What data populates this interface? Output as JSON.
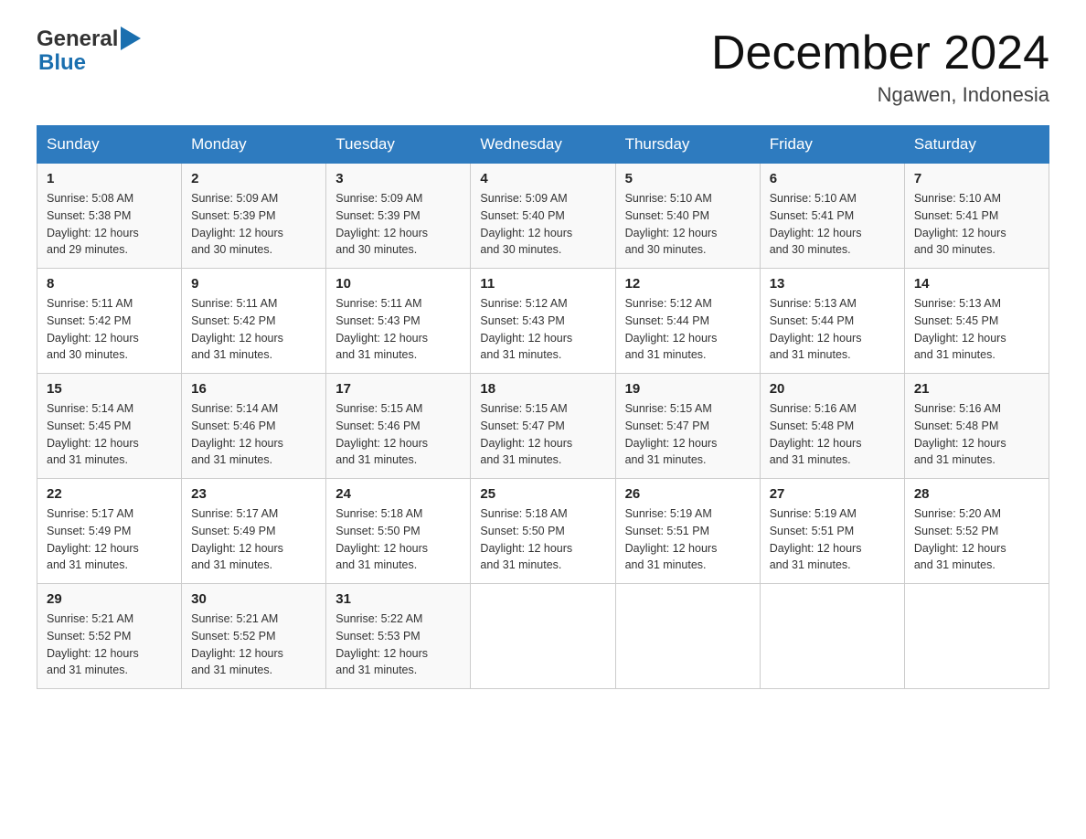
{
  "header": {
    "logo_general": "General",
    "logo_blue": "Blue",
    "month_title": "December 2024",
    "location": "Ngawen, Indonesia"
  },
  "days_of_week": [
    "Sunday",
    "Monday",
    "Tuesday",
    "Wednesday",
    "Thursday",
    "Friday",
    "Saturday"
  ],
  "weeks": [
    {
      "days": [
        {
          "num": "1",
          "sunrise": "5:08 AM",
          "sunset": "5:38 PM",
          "daylight": "12 hours and 29 minutes."
        },
        {
          "num": "2",
          "sunrise": "5:09 AM",
          "sunset": "5:39 PM",
          "daylight": "12 hours and 30 minutes."
        },
        {
          "num": "3",
          "sunrise": "5:09 AM",
          "sunset": "5:39 PM",
          "daylight": "12 hours and 30 minutes."
        },
        {
          "num": "4",
          "sunrise": "5:09 AM",
          "sunset": "5:40 PM",
          "daylight": "12 hours and 30 minutes."
        },
        {
          "num": "5",
          "sunrise": "5:10 AM",
          "sunset": "5:40 PM",
          "daylight": "12 hours and 30 minutes."
        },
        {
          "num": "6",
          "sunrise": "5:10 AM",
          "sunset": "5:41 PM",
          "daylight": "12 hours and 30 minutes."
        },
        {
          "num": "7",
          "sunrise": "5:10 AM",
          "sunset": "5:41 PM",
          "daylight": "12 hours and 30 minutes."
        }
      ]
    },
    {
      "days": [
        {
          "num": "8",
          "sunrise": "5:11 AM",
          "sunset": "5:42 PM",
          "daylight": "12 hours and 30 minutes."
        },
        {
          "num": "9",
          "sunrise": "5:11 AM",
          "sunset": "5:42 PM",
          "daylight": "12 hours and 31 minutes."
        },
        {
          "num": "10",
          "sunrise": "5:11 AM",
          "sunset": "5:43 PM",
          "daylight": "12 hours and 31 minutes."
        },
        {
          "num": "11",
          "sunrise": "5:12 AM",
          "sunset": "5:43 PM",
          "daylight": "12 hours and 31 minutes."
        },
        {
          "num": "12",
          "sunrise": "5:12 AM",
          "sunset": "5:44 PM",
          "daylight": "12 hours and 31 minutes."
        },
        {
          "num": "13",
          "sunrise": "5:13 AM",
          "sunset": "5:44 PM",
          "daylight": "12 hours and 31 minutes."
        },
        {
          "num": "14",
          "sunrise": "5:13 AM",
          "sunset": "5:45 PM",
          "daylight": "12 hours and 31 minutes."
        }
      ]
    },
    {
      "days": [
        {
          "num": "15",
          "sunrise": "5:14 AM",
          "sunset": "5:45 PM",
          "daylight": "12 hours and 31 minutes."
        },
        {
          "num": "16",
          "sunrise": "5:14 AM",
          "sunset": "5:46 PM",
          "daylight": "12 hours and 31 minutes."
        },
        {
          "num": "17",
          "sunrise": "5:15 AM",
          "sunset": "5:46 PM",
          "daylight": "12 hours and 31 minutes."
        },
        {
          "num": "18",
          "sunrise": "5:15 AM",
          "sunset": "5:47 PM",
          "daylight": "12 hours and 31 minutes."
        },
        {
          "num": "19",
          "sunrise": "5:15 AM",
          "sunset": "5:47 PM",
          "daylight": "12 hours and 31 minutes."
        },
        {
          "num": "20",
          "sunrise": "5:16 AM",
          "sunset": "5:48 PM",
          "daylight": "12 hours and 31 minutes."
        },
        {
          "num": "21",
          "sunrise": "5:16 AM",
          "sunset": "5:48 PM",
          "daylight": "12 hours and 31 minutes."
        }
      ]
    },
    {
      "days": [
        {
          "num": "22",
          "sunrise": "5:17 AM",
          "sunset": "5:49 PM",
          "daylight": "12 hours and 31 minutes."
        },
        {
          "num": "23",
          "sunrise": "5:17 AM",
          "sunset": "5:49 PM",
          "daylight": "12 hours and 31 minutes."
        },
        {
          "num": "24",
          "sunrise": "5:18 AM",
          "sunset": "5:50 PM",
          "daylight": "12 hours and 31 minutes."
        },
        {
          "num": "25",
          "sunrise": "5:18 AM",
          "sunset": "5:50 PM",
          "daylight": "12 hours and 31 minutes."
        },
        {
          "num": "26",
          "sunrise": "5:19 AM",
          "sunset": "5:51 PM",
          "daylight": "12 hours and 31 minutes."
        },
        {
          "num": "27",
          "sunrise": "5:19 AM",
          "sunset": "5:51 PM",
          "daylight": "12 hours and 31 minutes."
        },
        {
          "num": "28",
          "sunrise": "5:20 AM",
          "sunset": "5:52 PM",
          "daylight": "12 hours and 31 minutes."
        }
      ]
    },
    {
      "days": [
        {
          "num": "29",
          "sunrise": "5:21 AM",
          "sunset": "5:52 PM",
          "daylight": "12 hours and 31 minutes."
        },
        {
          "num": "30",
          "sunrise": "5:21 AM",
          "sunset": "5:52 PM",
          "daylight": "12 hours and 31 minutes."
        },
        {
          "num": "31",
          "sunrise": "5:22 AM",
          "sunset": "5:53 PM",
          "daylight": "12 hours and 31 minutes."
        },
        null,
        null,
        null,
        null
      ]
    }
  ],
  "labels": {
    "sunrise": "Sunrise:",
    "sunset": "Sunset:",
    "daylight": "Daylight:"
  }
}
